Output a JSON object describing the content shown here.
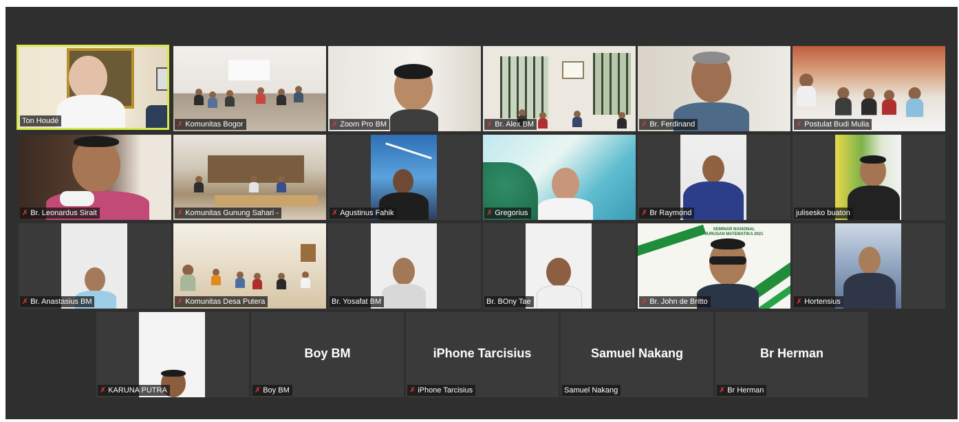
{
  "participants": [
    {
      "name": "Ton Houdé",
      "muted": false,
      "active": true
    },
    {
      "name": "Komunitas Bogor",
      "muted": true
    },
    {
      "name": "Zoom Pro BM",
      "muted": true
    },
    {
      "name": "Br. Alex BM",
      "muted": true
    },
    {
      "name": "Br. Ferdinand",
      "muted": true
    },
    {
      "name": "Postulat Budi Mulia",
      "muted": true
    },
    {
      "name": "Br. Leonardus Sirait",
      "muted": true
    },
    {
      "name": "Komunitas Gunung Sahari -",
      "muted": true
    },
    {
      "name": "Agustinus Fahik",
      "muted": true
    },
    {
      "name": "Gregorius",
      "muted": true
    },
    {
      "name": "Br Raymond",
      "muted": true
    },
    {
      "name": "julisesko buaton",
      "muted": false
    },
    {
      "name": "Br. Anastasius BM",
      "muted": true
    },
    {
      "name": "Komunitas Desa Putera",
      "muted": true
    },
    {
      "name": "Br. Yosafat BM",
      "muted": false
    },
    {
      "name": "Br. BOny Tae",
      "muted": false
    },
    {
      "name": "Br. John de Britto",
      "muted": true
    },
    {
      "name": "Hortensius",
      "muted": true
    },
    {
      "name": "KARUNA PUTRA",
      "muted": true
    },
    {
      "name": "Boy BM",
      "muted": true,
      "video_off_name": "Boy BM"
    },
    {
      "name": "iPhone Tarcisius",
      "muted": true,
      "video_off_name": "iPhone Tarcisius"
    },
    {
      "name": "Samuel Nakang",
      "muted": false,
      "video_off_name": "Samuel Nakang"
    },
    {
      "name": "Br Herman",
      "muted": true,
      "video_off_name": "Br Herman"
    }
  ],
  "seminar_banner": {
    "line1": "SEMINAR NASIONAL",
    "line2": "JURUSAN MATEMATIKA 2021"
  },
  "icons": {
    "muted": "mic-muted-icon"
  },
  "colors": {
    "background": "#2f2f2f",
    "active_border": "#d6e84a",
    "muted_icon": "#e0383a"
  }
}
